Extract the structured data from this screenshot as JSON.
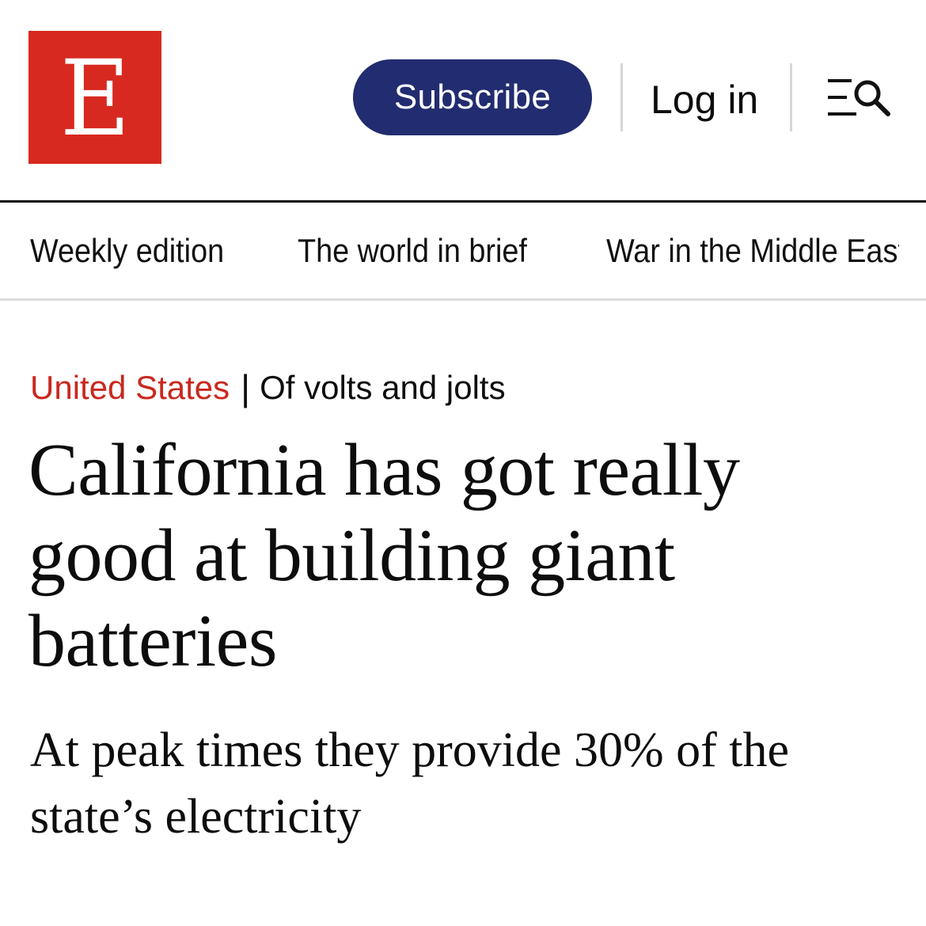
{
  "header": {
    "logo_letter": "E",
    "subscribe_label": "Subscribe",
    "login_label": "Log in",
    "menu_search_icon": "menu-search-icon",
    "colors": {
      "brand_red": "#d7291f",
      "subscribe_blue": "#222c70",
      "section_red": "#c9281e"
    }
  },
  "nav": {
    "items": [
      {
        "label": "Weekly edition"
      },
      {
        "label": "The world in brief"
      },
      {
        "label": "War in the Middle East"
      }
    ]
  },
  "article": {
    "section": "United States",
    "separator": "|",
    "flytitle": "Of volts and jolts",
    "headline": "California has got really good at building giant batteries",
    "rubric": "At peak times they provide 30% of the state’s electricity"
  }
}
